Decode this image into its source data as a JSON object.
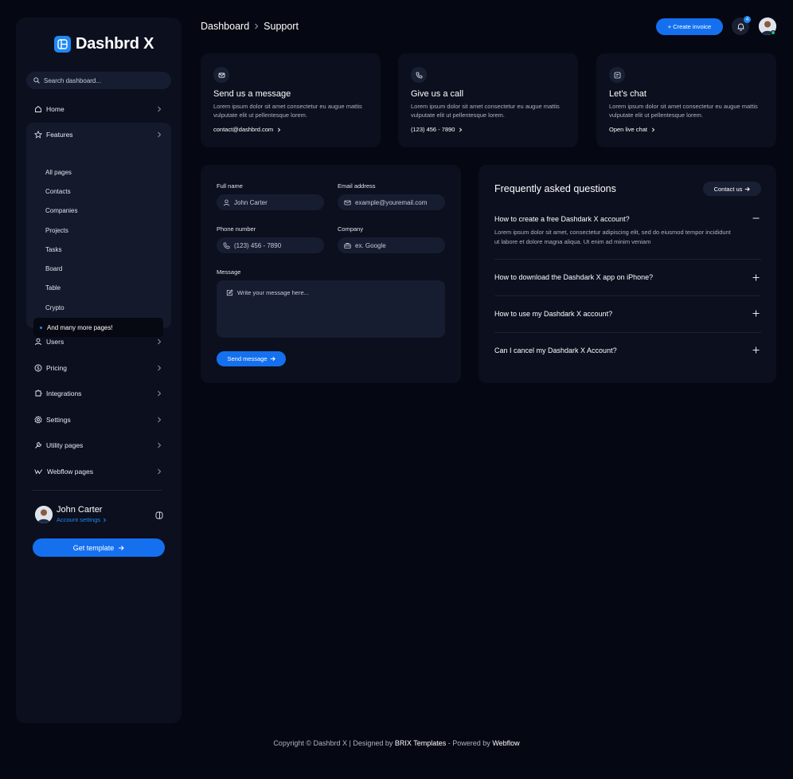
{
  "app": {
    "name": "Dashbrd X"
  },
  "sidebar": {
    "search_placeholder": "Search dashboard...",
    "items": [
      {
        "label": "Home"
      },
      {
        "label": "Features"
      },
      {
        "label": "Users"
      },
      {
        "label": "Pricing"
      },
      {
        "label": "Integrations"
      },
      {
        "label": "Settings"
      },
      {
        "label": "Utility pages"
      },
      {
        "label": "Webflow pages"
      }
    ],
    "features_sub": [
      "All pages",
      "Contacts",
      "Companies",
      "Projects",
      "Tasks",
      "Board",
      "Table",
      "Crypto",
      "And many more pages!"
    ],
    "user": {
      "name": "John Carter",
      "link": "Account settings"
    },
    "cta": "Get template"
  },
  "header": {
    "breadcrumb": [
      "Dashboard",
      "Support"
    ],
    "create_label": "+ Create invoice",
    "notifications": "4"
  },
  "cards": [
    {
      "title": "Send us a message",
      "text": "Lorem ipsum dolor sit amet consectetur eu augue mattis vulputate elit ut pellentesque lorem.",
      "link": "contact@dashbrd.com",
      "icon": "mail-icon"
    },
    {
      "title": "Give us a call",
      "text": "Lorem ipsum dolor sit amet consectetur eu augue mattis vulputate elit ut pellentesque lorem.",
      "link": "(123) 456 - 7890",
      "icon": "phone-icon"
    },
    {
      "title": "Let’s chat",
      "text": "Lorem ipsum dolor sit amet consectetur eu augue mattis vulputate elit ut pellentesque lorem.",
      "link": "Open live chat",
      "icon": "chat-icon"
    }
  ],
  "form": {
    "full_name": {
      "label": "Full name",
      "placeholder": "John Carter"
    },
    "email": {
      "label": "Email address",
      "placeholder": "example@youremail.com"
    },
    "phone": {
      "label": "Phone number",
      "placeholder": "(123) 456 - 7890"
    },
    "company": {
      "label": "Company",
      "placeholder": "ex. Google"
    },
    "message": {
      "label": "Message",
      "placeholder": "Write your message here..."
    },
    "submit": "Send message"
  },
  "faq": {
    "title": "Frequently asked questions",
    "contact": "Contact us",
    "items": [
      {
        "q": "How to create a free Dashdark X account?",
        "a": "Lorem ipsum dolor sit amet, consectetur adipiscing elit, sed do eiusmod tempor incididunt ut labore et dolore magna aliqua. Ut enim ad minim veniam",
        "open": true
      },
      {
        "q": "How to download the Dashdark X app on iPhone?",
        "open": false
      },
      {
        "q": "How to use my Dashdark X account?",
        "open": false
      },
      {
        "q": "Can I cancel my Dashdark X Account?",
        "open": false
      }
    ]
  },
  "footer": {
    "prefix": "Copyright © Dashbrd X | Designed by",
    "brand": "BRIX Templates",
    "mid": "- Powered by",
    "platform": "Webflow"
  },
  "colors": {
    "accent": "#1570ef",
    "background": "#050812",
    "panel": "#0b0f1e",
    "online": "#16c784"
  }
}
